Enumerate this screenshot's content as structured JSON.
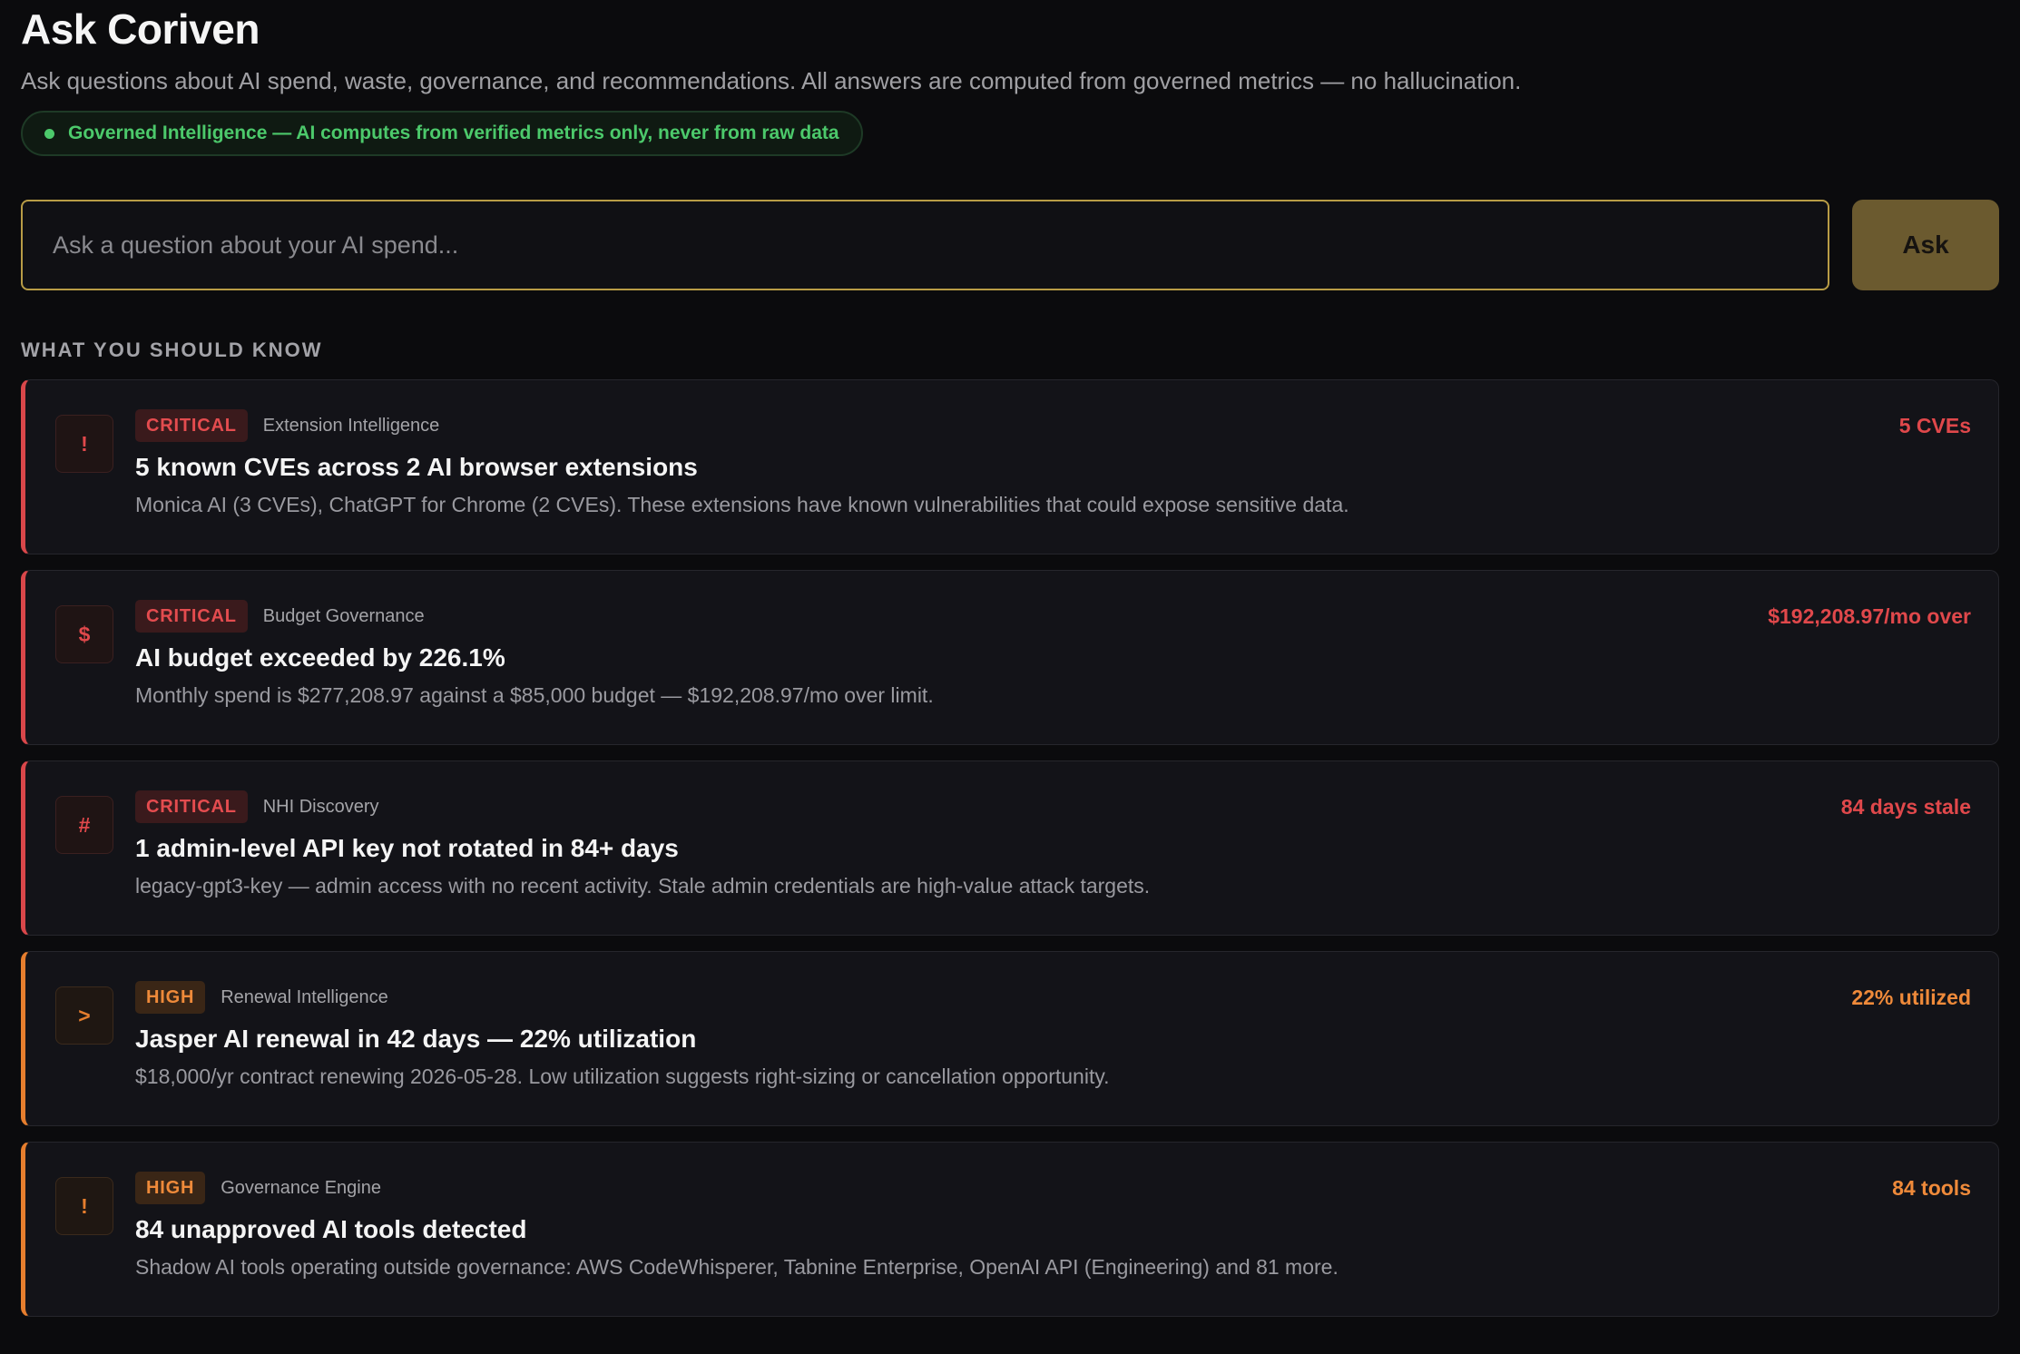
{
  "header": {
    "title": "Ask Coriven",
    "subtitle": "Ask questions about AI spend, waste, governance, and recommendations. All answers are computed from governed metrics — no hallucination.",
    "badge": "Governed Intelligence — AI computes from verified metrics only, never from raw data"
  },
  "ask": {
    "placeholder": "Ask a question about your AI spend...",
    "value": "",
    "button_label": "Ask"
  },
  "insights": {
    "section_label": "WHAT YOU SHOULD KNOW",
    "items": [
      {
        "severity": "CRITICAL",
        "source": "Extension Intelligence",
        "icon": "!",
        "icon_name": "alert-icon",
        "metric": "5 CVEs",
        "title": "5 known CVEs across 2 AI browser extensions",
        "description": "Monica AI (3 CVEs), ChatGPT for Chrome (2 CVEs). These extensions have known vulnerabilities that could expose sensitive data."
      },
      {
        "severity": "CRITICAL",
        "source": "Budget Governance",
        "icon": "$",
        "icon_name": "dollar-icon",
        "metric": "$192,208.97/mo over",
        "title": "AI budget exceeded by 226.1%",
        "description": "Monthly spend is $277,208.97 against a $85,000 budget — $192,208.97/mo over limit."
      },
      {
        "severity": "CRITICAL",
        "source": "NHI Discovery",
        "icon": "#",
        "icon_name": "hash-icon",
        "metric": "84 days stale",
        "title": "1 admin-level API key not rotated in 84+ days",
        "description": "legacy-gpt3-key — admin access with no recent activity. Stale admin credentials are high-value attack targets."
      },
      {
        "severity": "HIGH",
        "source": "Renewal Intelligence",
        "icon": ">",
        "icon_name": "chevron-right-icon",
        "metric": "22% utilized",
        "title": "Jasper AI renewal in 42 days — 22% utilization",
        "description": "$18,000/yr contract renewing 2026-05-28. Low utilization suggests right-sizing or cancellation opportunity."
      },
      {
        "severity": "HIGH",
        "source": "Governance Engine",
        "icon": "!",
        "icon_name": "alert-icon",
        "metric": "84 tools",
        "title": "84 unapproved AI tools detected",
        "description": "Shadow AI tools operating outside governance: AWS CodeWhisperer, Tabnine Enterprise, OpenAI API (Engineering) and 81 more."
      }
    ]
  },
  "colors": {
    "critical": "#e0484b",
    "high": "#e67e2e",
    "governed": "#4cc96b",
    "accent": "#b89c46"
  }
}
